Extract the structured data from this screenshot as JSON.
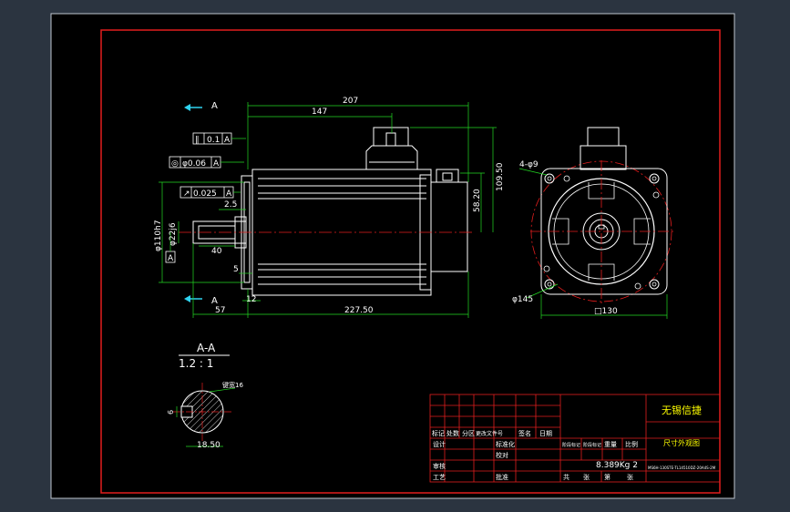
{
  "colors": {
    "background_outer": "#2b3440",
    "drawing_bg": "#000000",
    "frame_red": "#e21e1e",
    "outline_white": "#ffffff",
    "dimension_green": "#23d823",
    "arrow_cyan": "#2fd3f0",
    "centerline_red": "#e21e1e",
    "title_yellow": "#ffff00"
  },
  "section_markers": {
    "top": "A",
    "bottom": "A"
  },
  "tolerances": {
    "parallel": "0.1",
    "parallel_datum": "A",
    "concentric": "φ0.06",
    "concentric_datum": "A",
    "runout": "0.025",
    "runout_datum": "A",
    "datum_label": "A"
  },
  "dimensions": {
    "overall_length": "207",
    "body_length": "147",
    "height_total": "109.50",
    "height_connector": "58.20",
    "shaft_step": "2.5",
    "shaft_key_length": "40",
    "flange_offset": "5",
    "flange_thickness": "12",
    "shaft_length": "57",
    "length_with_shaft": "227.50",
    "pilot_diameter": "φ110h7",
    "shaft_diameter": "φ22j6",
    "bolt_holes": "4-φ9",
    "pcd": "φ145",
    "flange_square": "□130"
  },
  "section": {
    "title": "A-A",
    "scale": "1.2 : 1",
    "key_width": "6",
    "key_depth": "18.50",
    "note": "键宽16"
  },
  "title_block": {
    "company": "无锡信捷",
    "drawing_name": "尺寸外观图",
    "weight": "8.389Kg 2",
    "part_number": "MS6H-130STE-TL14510DZ-20A4S-2M",
    "col_labels": [
      "标记",
      "处数",
      "分区",
      "更改文件号",
      "签名",
      "日期"
    ],
    "row_labels": [
      "设计",
      "审核",
      "工艺",
      "标准化",
      "批准",
      "校对"
    ],
    "stage_labels": [
      "阶段标记",
      "阶段标记",
      "重量",
      "比例"
    ],
    "sheet_labels": [
      "共",
      "张",
      "第",
      "张"
    ]
  }
}
